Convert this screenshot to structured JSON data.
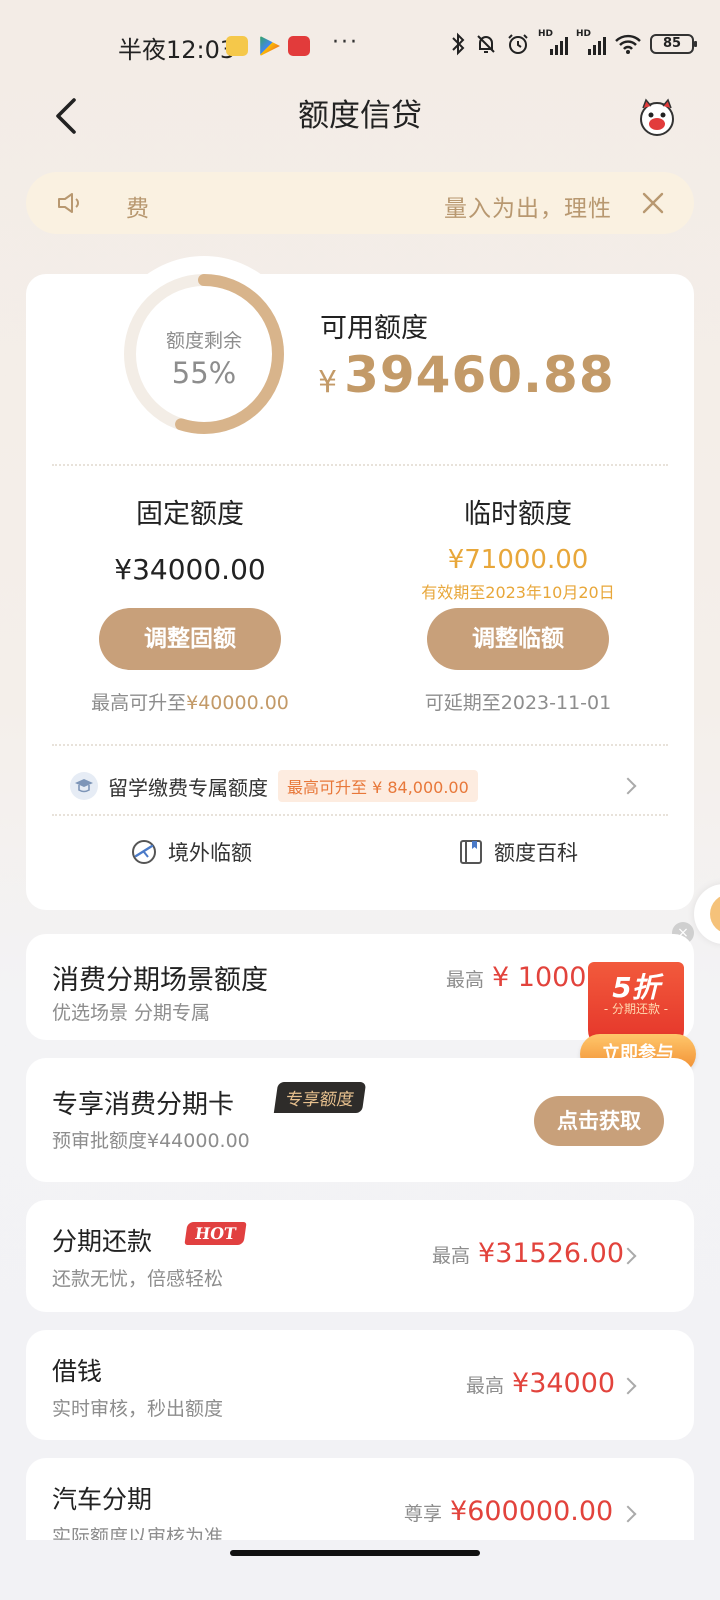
{
  "status_bar": {
    "time": "半夜12:03",
    "more_dots": "···",
    "battery": "85",
    "hd1": "HD",
    "hd2": "HD"
  },
  "header": {
    "title": "额度信贷"
  },
  "notice": {
    "left_text": "费",
    "right_text": "量入为出，理性"
  },
  "quota": {
    "ring_label": "额度剩余",
    "ring_percent": "55%",
    "ring_fraction": 0.55,
    "available_label": "可用额度",
    "available_currency": "¥",
    "available_amount": "39460.88",
    "fixed": {
      "title": "固定额度",
      "amount": "¥34000.00",
      "button": "调整固额",
      "hint_prefix": "最高可升至",
      "hint_value": "¥40000.00"
    },
    "temporary": {
      "title": "临时额度",
      "amount": "¥71000.00",
      "validity": "有效期至2023年10月20日",
      "button": "调整临额",
      "hint": "可延期至2023-11-01"
    },
    "study": {
      "label": "留学缴费专属额度",
      "badge": "最高可升至 ¥ 84,000.00"
    },
    "tools": {
      "overseas": "境外临额",
      "encyclopedia": "额度百科"
    }
  },
  "scene": {
    "title": "消费分期场景额度",
    "subtitle": "优选场景 分期专属",
    "prefix": "最高",
    "amount": "¥ 10000"
  },
  "promo": {
    "main": "5折",
    "sub": "- 分期还款 -",
    "button": "立即参与"
  },
  "card_exclusive": {
    "title": "专享消费分期卡",
    "badge": "专享额度",
    "subtitle": "预审批额度¥44000.00",
    "button": "点击获取"
  },
  "installment": {
    "title": "分期还款",
    "badge": "HOT",
    "subtitle": "还款无忧，倍感轻松",
    "prefix": "最高",
    "amount": "¥31526.00"
  },
  "borrow": {
    "title": "借钱",
    "subtitle": "实时审核，秒出额度",
    "prefix": "最高",
    "amount": "¥34000"
  },
  "car": {
    "title": "汽车分期",
    "subtitle": "实际额度以审核为准",
    "prefix": "尊享",
    "amount": "¥600000.00"
  },
  "colors": {
    "gold": "#c39a68",
    "button_gold": "#c8a07a",
    "orange": "#e8a73a",
    "red": "#e2433c"
  }
}
